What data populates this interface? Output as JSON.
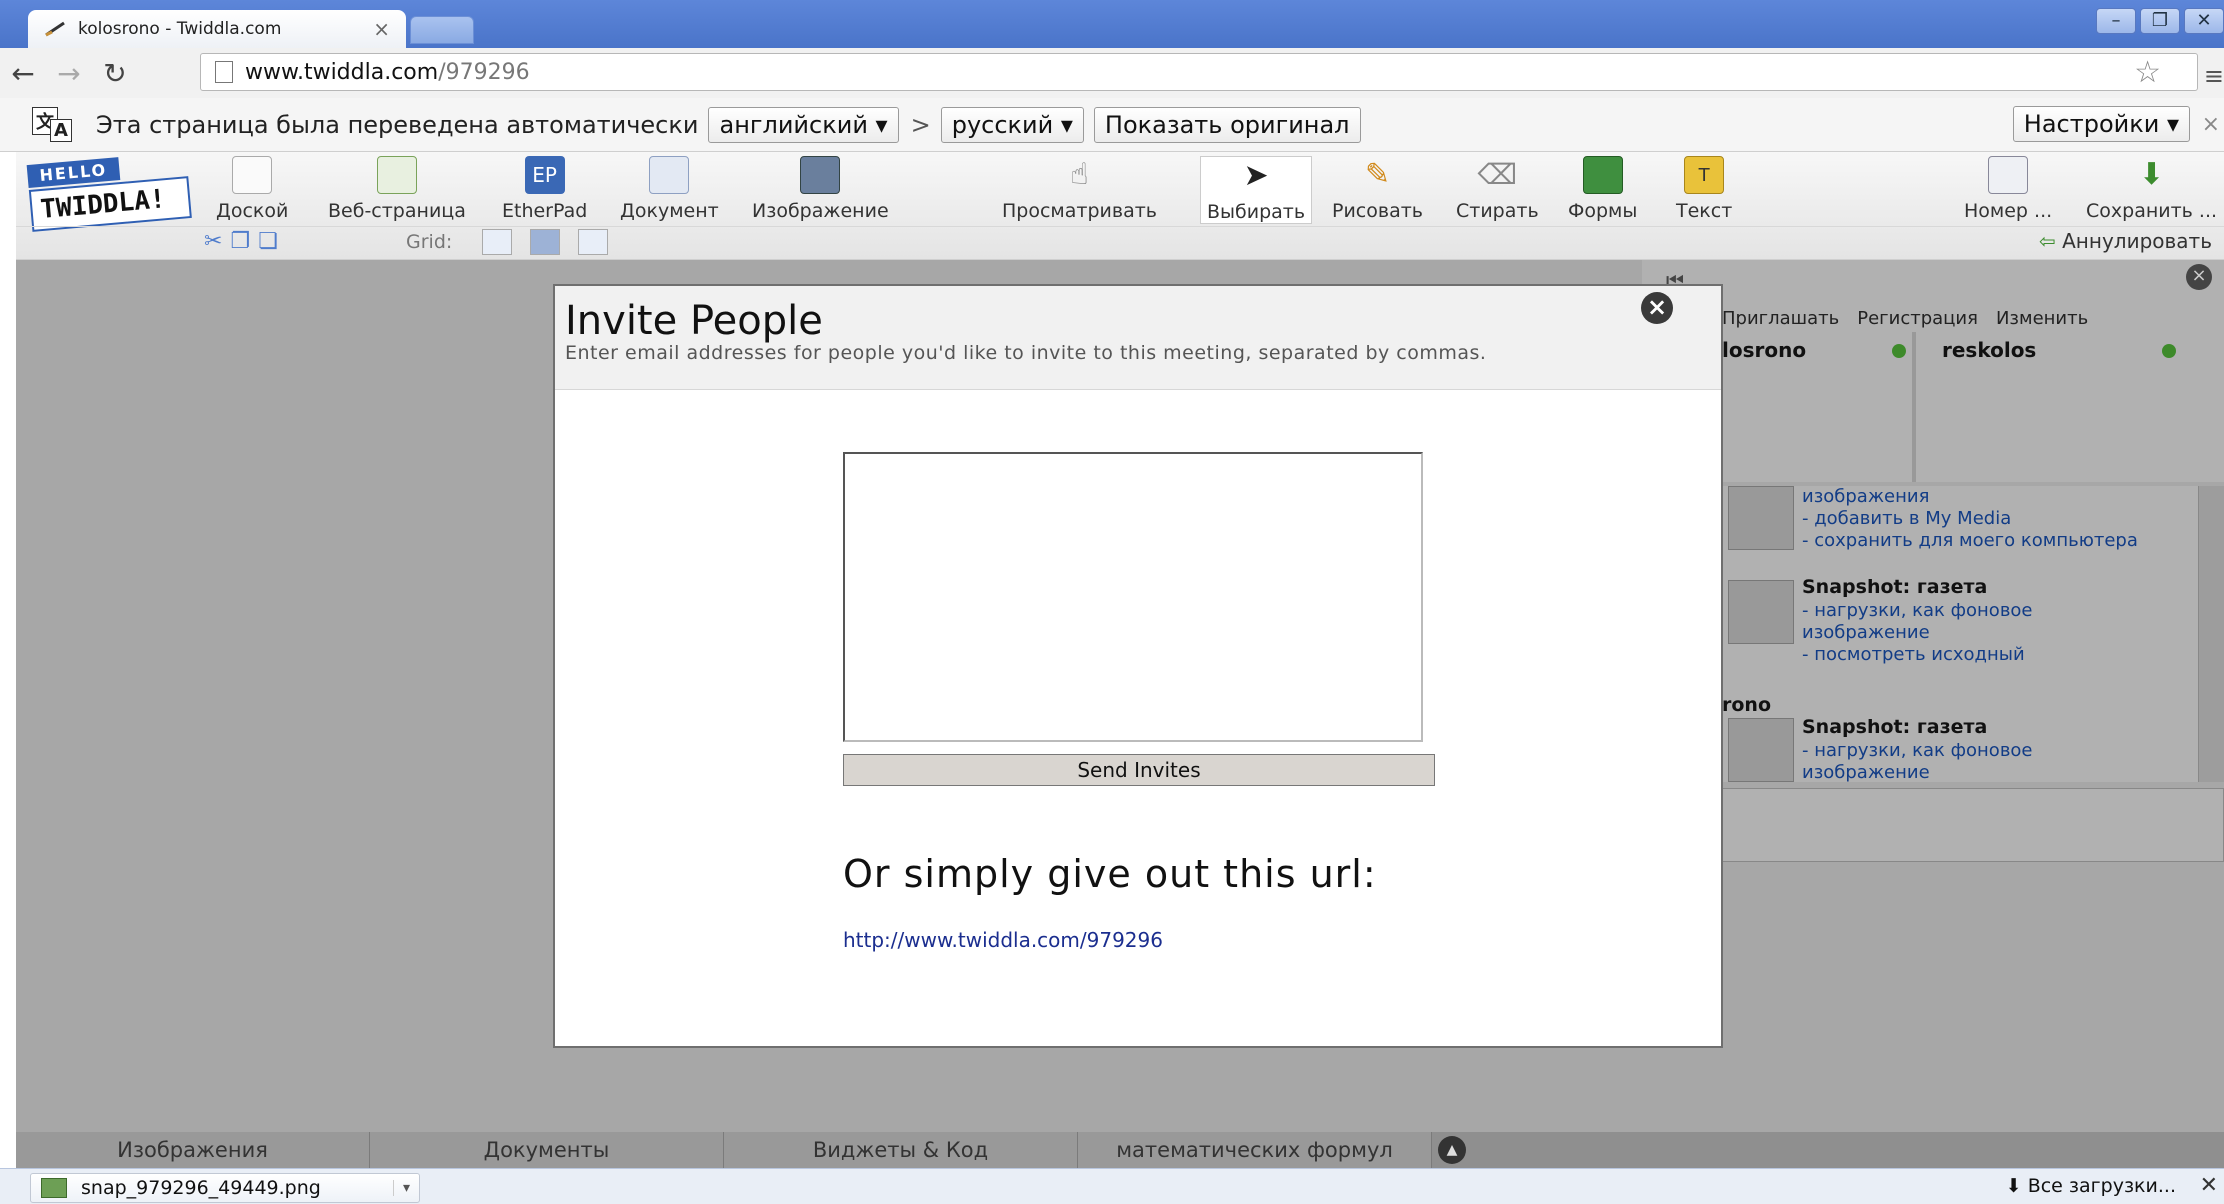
{
  "browser": {
    "tab_title": "kolosrono - Twiddla.com",
    "tab_close": "×",
    "url_host": "www.twiddla.com",
    "url_path": "/979296",
    "window_buttons": [
      "–",
      "❐",
      "✕"
    ]
  },
  "translate_bar": {
    "message": "Эта страница была переведена автоматически",
    "from_lang": "английский ▾",
    "arrow": ">",
    "to_lang": "русский ▾",
    "show_original": "Показать оригинал",
    "settings": "Настройки ▾",
    "close": "×"
  },
  "app": {
    "logo_top": "HELLO",
    "logo_bottom": "TWIDDLA!",
    "tools": [
      {
        "label": "Доской"
      },
      {
        "label": "Веб-страница"
      },
      {
        "label": "EtherPad"
      },
      {
        "label": "Документ"
      },
      {
        "label": "Изображение"
      },
      {
        "label": "Просматривать"
      },
      {
        "label": "Выбирать"
      },
      {
        "label": "Рисовать"
      },
      {
        "label": "Стирать"
      },
      {
        "label": "Формы"
      },
      {
        "label": "Текст"
      },
      {
        "label": "Номер ..."
      },
      {
        "label": "Сохранить ..."
      }
    ],
    "grid_label": "Grid:",
    "undo_label": "Аннулировать"
  },
  "right_panel": {
    "actions": [
      "Приглашать",
      "Регистрация",
      "Изменить"
    ],
    "users": [
      "losrono",
      "reskolos"
    ],
    "snapshots": [
      {
        "links": [
          "изображения",
          "- добавить в My Media",
          "- сохранить для моего компьютера"
        ]
      },
      {
        "title": "Snapshot: газета",
        "links": [
          "- нагрузки, как фоновое",
          "изображение",
          "- посмотреть исходный"
        ]
      },
      {
        "author": "rono",
        "title": "Snapshot: газета",
        "links": [
          "- нагрузки, как фоновое",
          "изображение"
        ]
      }
    ]
  },
  "bottom_tabs": [
    "Изображения",
    "Документы",
    "Виджеты & Код",
    "математических формул"
  ],
  "downloads": {
    "file": "snap_979296_49449.png",
    "all_label": "Все загрузки..."
  },
  "modal": {
    "title": "Invite People",
    "subtitle": "Enter email addresses for people you'd like to invite to this meeting, separated by commas.",
    "email_value": "",
    "send_button": "Send Invites",
    "or_text": "Or simply give out this url:",
    "share_url": "http://www.twiddla.com/979296",
    "close_symbol": "×"
  }
}
